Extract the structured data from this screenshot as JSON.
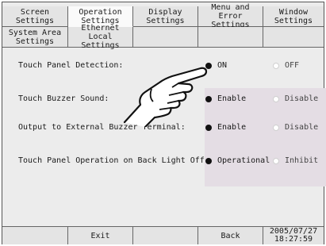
{
  "tabs_row1": [
    {
      "label": "Screen\nSettings",
      "active": false
    },
    {
      "label": "Operation\nSettings",
      "active": true
    },
    {
      "label": "Display\nSettings",
      "active": false
    },
    {
      "label": "Menu and\nError Settings",
      "active": false
    },
    {
      "label": "Window\nSettings",
      "active": false
    }
  ],
  "tabs_row2": [
    {
      "label": "System Area\nSettings"
    },
    {
      "label": "Ethernet\nLocal Settings"
    }
  ],
  "settings": [
    {
      "label": "Touch Panel Detection:",
      "options": [
        "ON",
        "OFF"
      ],
      "selected": 0
    },
    {
      "label": "Touch Buzzer Sound:",
      "options": [
        "Enable",
        "Disable"
      ],
      "selected": 0
    },
    {
      "label": "Output to External Buzzer Terminal:",
      "options": [
        "Enable",
        "Disable"
      ],
      "selected": 0
    },
    {
      "label": "Touch Panel Operation on Back Light Off:",
      "options": [
        "Operational",
        "Inhibit"
      ],
      "selected": 0
    }
  ],
  "bottom": {
    "exit_label": "Exit",
    "back_label": "Back",
    "date": "2005/07/27",
    "time": "18:27:59"
  },
  "icons": {
    "pointer": "pointing-hand-icon",
    "radio_selected": "radio-selected-icon",
    "radio_unselected": "radio-unselected-icon"
  },
  "colors": {
    "background": "#ececec",
    "highlight_area": "#e4dde4",
    "radio_selected": "#111111"
  }
}
